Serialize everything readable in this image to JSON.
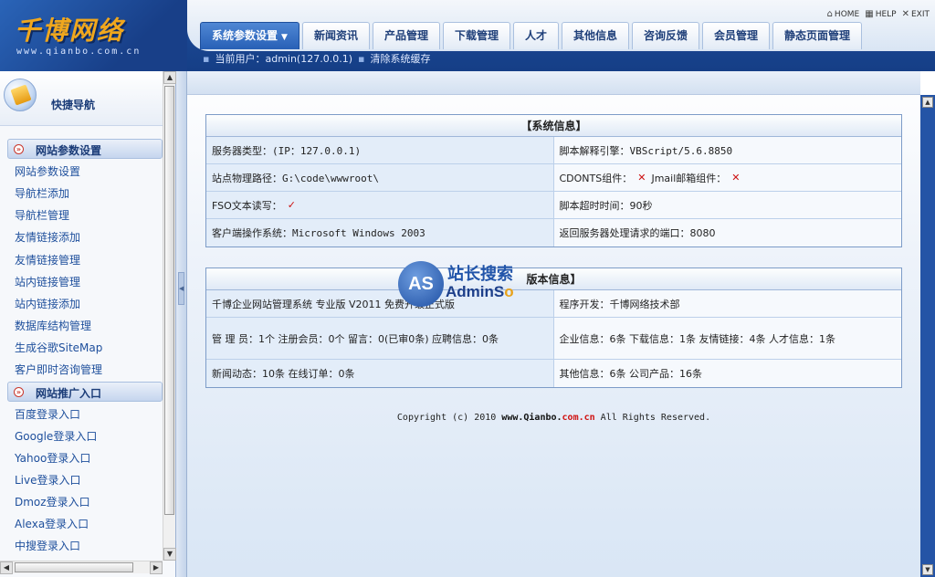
{
  "logo": {
    "title": "千博网络",
    "url": "www.qianbo.com.cn"
  },
  "top_buttons": [
    {
      "icon": "home-icon",
      "label": "HOME"
    },
    {
      "icon": "help-icon",
      "label": "HELP"
    },
    {
      "icon": "exit-icon",
      "label": "EXIT"
    }
  ],
  "tabs": [
    {
      "label": "系统参数设置",
      "active": true
    },
    {
      "label": "新闻资讯"
    },
    {
      "label": "产品管理"
    },
    {
      "label": "下载管理"
    },
    {
      "label": "人才"
    },
    {
      "label": "其他信息"
    },
    {
      "label": "咨询反馈"
    },
    {
      "label": "会员管理"
    },
    {
      "label": "静态页面管理"
    }
  ],
  "subbar": {
    "current_user": "当前用户：admin(127.0.0.1)",
    "clear_cache": "清除系统缓存"
  },
  "sidebar": {
    "title": "快捷导航",
    "group1": {
      "label": "网站参数设置",
      "items": [
        "网站参数设置",
        "导航栏添加",
        "导航栏管理",
        "友情链接添加",
        "友情链接管理",
        "站内链接管理",
        "站内链接添加",
        "数据库结构管理",
        "生成谷歌SiteMap",
        "客户即时咨询管理"
      ]
    },
    "group2": {
      "label": "网站推广入口",
      "items": [
        "百度登录入口",
        "Google登录入口",
        "Yahoo登录入口",
        "Live登录入口",
        "Dmoz登录入口",
        "Alexa登录入口",
        "中搜登录入口"
      ]
    }
  },
  "system_info": {
    "title": "【系统信息】",
    "server_type": "服务器类型：(IP：127.0.0.1)",
    "script_engine": "脚本解释引擎：VBScript/5.6.8850",
    "physical_path": "站点物理路径：G:\\code\\wwwroot\\",
    "cdonts": "CDONTS组件：",
    "jmail": "Jmail邮箱组件：",
    "fso": "FSO文本读写：",
    "timeout": "脚本超时时间：90秒",
    "client_os": "客户端操作系统：Microsoft Windows 2003",
    "port": "返回服务器处理请求的端口：8080"
  },
  "version_info": {
    "title": "版本信息】",
    "product": "千博企业网站管理系统 专业版 V2011 免费升级正式版",
    "developer": "程序开发：千博网络技术部",
    "stats1": "管 理 员：1个 注册会员：0个 留言：0(已审0条) 应聘信息：0条",
    "stats2": "企业信息：6条 下载信息：1条 友情链接：4条 人才信息：1条",
    "stats3": "新闻动态：10条 在线订单：0条",
    "stats4": "其他信息：6条 公司产品：16条"
  },
  "watermark": {
    "circle": "AS",
    "cn": "站长搜索",
    "en_a": "AdminS",
    "en_b": "o"
  },
  "copyright": {
    "prefix": "Copyright (c) 2010 ",
    "domain_a": "www.Qianbo.",
    "domain_b": "com.cn",
    "suffix": " All Rights Reserved."
  },
  "colors": {
    "header_blue": "#1f4f9c",
    "tab_active": "#2860b6",
    "logo_orange": "#f0a71d",
    "mark_red": "#cc1111"
  }
}
